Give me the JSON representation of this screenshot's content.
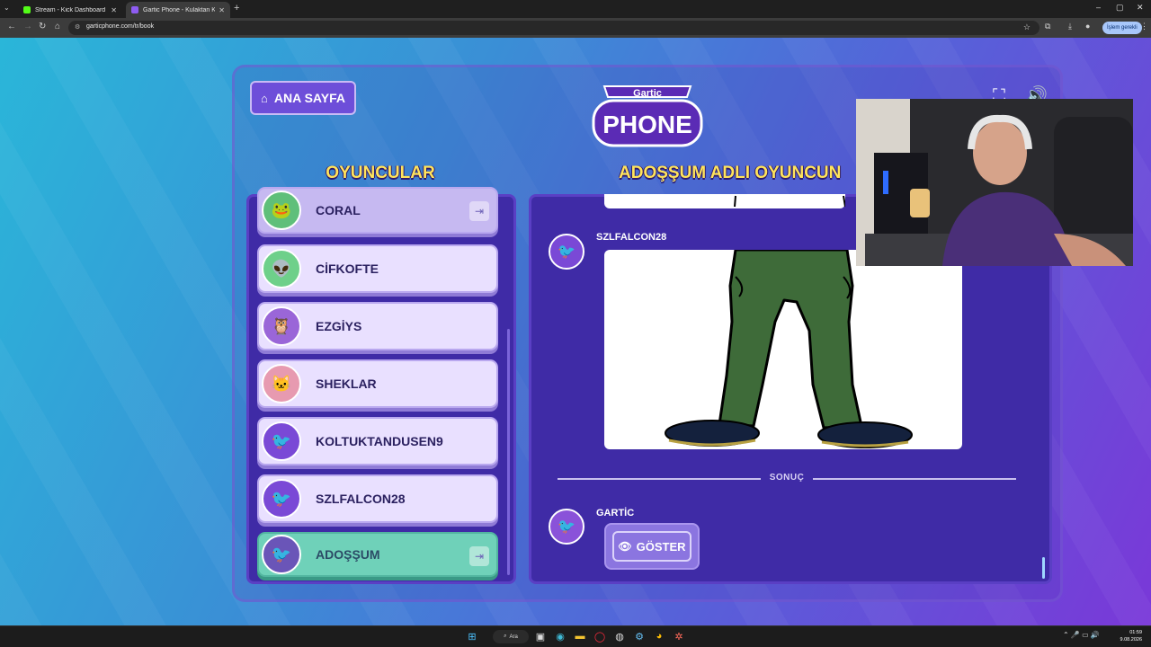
{
  "browser": {
    "tabs": [
      {
        "title": "Stream - Kick Dashboard",
        "favicon_color": "#53fc18",
        "active": false
      },
      {
        "title": "Gartic Phone - Kulaktan Kulağa",
        "favicon_color": "#8e5cf2",
        "active": true
      }
    ],
    "url": "garticphone.com/tr/book",
    "action_button": "İşlem gerekli"
  },
  "game": {
    "home_button": "ANA SAYFA",
    "logo_top": "Gartic",
    "logo_bottom": "PHONE",
    "players_heading": "OYUNCULAR",
    "album_heading": "ADOŞŞUM ADLI OYUNCUN",
    "players": [
      {
        "name": "CORAL",
        "avatar_color": "#5fbf7a",
        "avatar_glyph": "🐸",
        "state": "dim",
        "has_leave": true
      },
      {
        "name": "CİFKOFTE",
        "avatar_color": "#6ed08a",
        "avatar_glyph": "👽",
        "state": "normal",
        "has_leave": false
      },
      {
        "name": "EZGİYS",
        "avatar_color": "#9a66d8",
        "avatar_glyph": "🦉",
        "state": "normal",
        "has_leave": false
      },
      {
        "name": "SHEKLAR",
        "avatar_color": "#e79ab0",
        "avatar_glyph": "🐱",
        "state": "normal",
        "has_leave": false
      },
      {
        "name": "KOLTUKTANDUSEN9",
        "avatar_color": "#7a49d6",
        "avatar_glyph": "🐦",
        "state": "normal",
        "has_leave": false
      },
      {
        "name": "SZLFALCON28",
        "avatar_color": "#7a49d6",
        "avatar_glyph": "🐦",
        "state": "normal",
        "has_leave": false
      },
      {
        "name": "ADOŞŞUM",
        "avatar_color": "#6a55b8",
        "avatar_glyph": "🐦",
        "state": "self",
        "has_leave": true
      }
    ],
    "album": {
      "drawing_author": "SZLFALCON28",
      "result_label": "SONUÇ",
      "result_author": "GARTİC",
      "show_button": "GÖSTER"
    }
  },
  "taskbar": {
    "search_label": "Ara",
    "time": "01:59",
    "date": "9.08.2026"
  }
}
